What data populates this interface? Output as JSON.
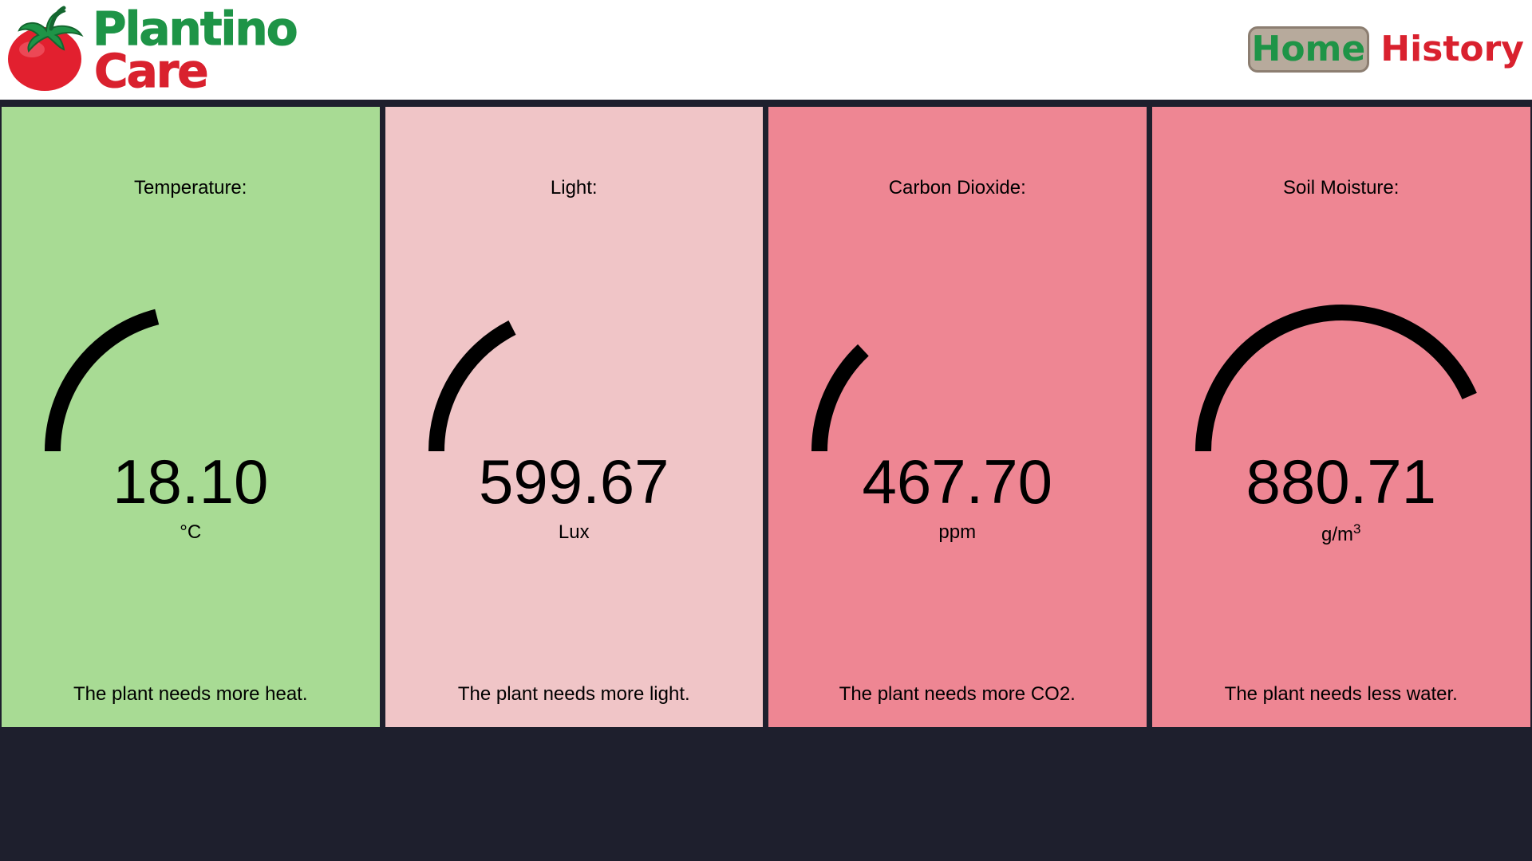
{
  "header": {
    "brand_line1": "Plantino",
    "brand_line2": "Care",
    "nav": {
      "home": "Home",
      "history": "History"
    }
  },
  "colors": {
    "brand_green": "#1e9447",
    "brand_red": "#d9212e",
    "good": "#a8db94",
    "warning": "#f0c5c7",
    "bad": "#ee8693",
    "background": "#1e1f2d"
  },
  "sensors": [
    {
      "title": "Temperature:",
      "value": "18.10",
      "unit": "°C",
      "status": "good",
      "color": "#a8db94",
      "gauge_fraction": 0.42,
      "message": "The plant needs more heat."
    },
    {
      "title": "Light:",
      "value": "599.67",
      "unit": "Lux",
      "status": "warning",
      "color": "#f0c5c7",
      "gauge_fraction": 0.35,
      "message": "The plant needs more light."
    },
    {
      "title": "Carbon Dioxide:",
      "value": "467.70",
      "unit": "ppm",
      "status": "bad",
      "color": "#ee8693",
      "gauge_fraction": 0.26,
      "message": "The plant needs more CO2."
    },
    {
      "title": "Soil Moisture:",
      "value": "880.71",
      "unit": "g/m",
      "unit_superscript": "3",
      "status": "bad",
      "color": "#ee8693",
      "gauge_fraction": 0.87,
      "message": "The plant needs less water."
    }
  ]
}
